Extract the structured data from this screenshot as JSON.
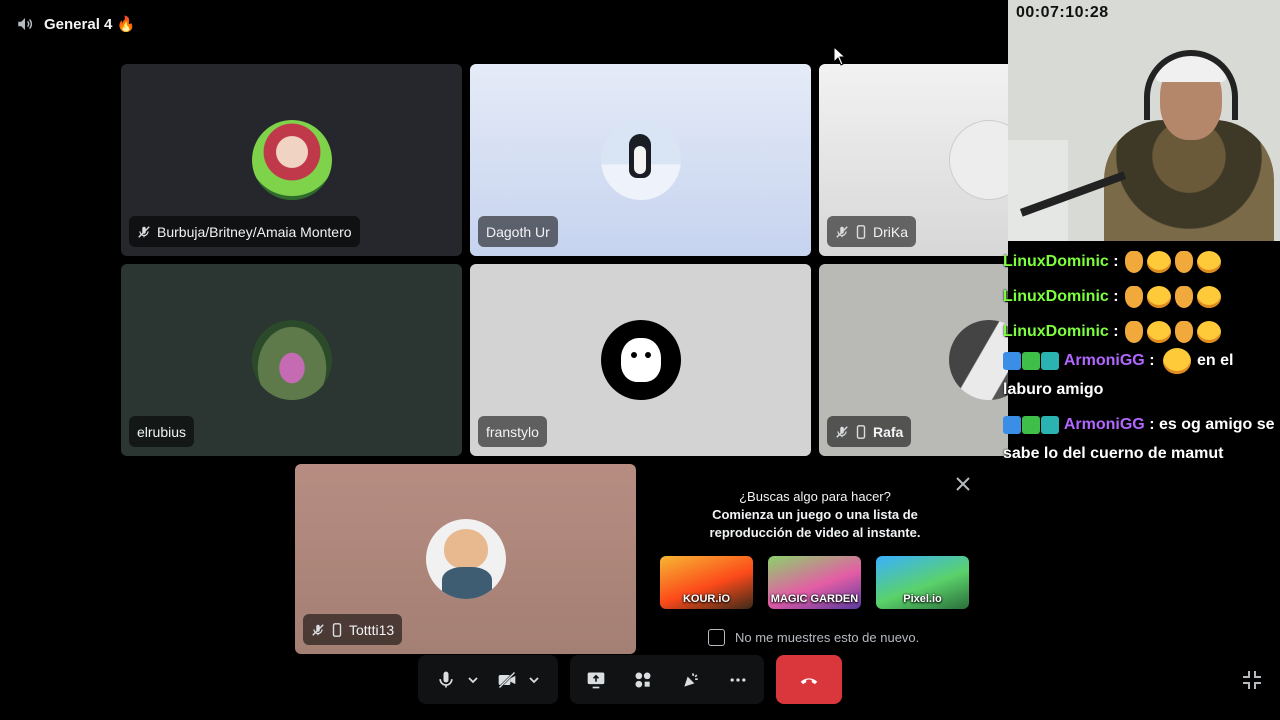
{
  "channel": {
    "name": "General 4",
    "emoji": "🔥"
  },
  "participants": [
    {
      "name": "Burbuja/Britney/Amaia Montero",
      "muted": true,
      "mobile": false
    },
    {
      "name": "Dagoth Ur",
      "muted": false,
      "mobile": false
    },
    {
      "name": "DriKa",
      "muted": true,
      "mobile": true
    },
    {
      "name": "elrubius",
      "muted": false,
      "mobile": false
    },
    {
      "name": "franstylo",
      "muted": false,
      "mobile": false
    },
    {
      "name": "Rafa",
      "muted": true,
      "mobile": true
    },
    {
      "name": "Tottti13",
      "muted": true,
      "mobile": true
    }
  ],
  "activity_promo": {
    "line1": "¿Buscas algo para hacer?",
    "line2": "Comienza un juego o una lista de",
    "line3": "reproducción de video al instante.",
    "games": [
      "KOUR.iO",
      "MAGIC GARDEN",
      "Pixel.io"
    ],
    "dismiss_label": "No me muestres esto de nuevo."
  },
  "stream_overlay": {
    "timer": "00:07:10:28",
    "chat": [
      {
        "user": "LinuxDominic",
        "sep": " : ",
        "text": ""
      },
      {
        "user": "LinuxDominic",
        "sep": " : ",
        "text": ""
      },
      {
        "user": "LinuxDominic",
        "sep": " : ",
        "text": ""
      },
      {
        "user": "ArmoniGG",
        "sep": " : ",
        "text": "en el laburo amigo"
      },
      {
        "user": "ArmoniGG",
        "sep": " : ",
        "text": "es og amigo se sabe lo del cuerno de mamut"
      }
    ]
  },
  "colors": {
    "hangup": "#da373c",
    "chat_user_green": "#7cff3d",
    "chat_user_purple": "#b266ff"
  }
}
